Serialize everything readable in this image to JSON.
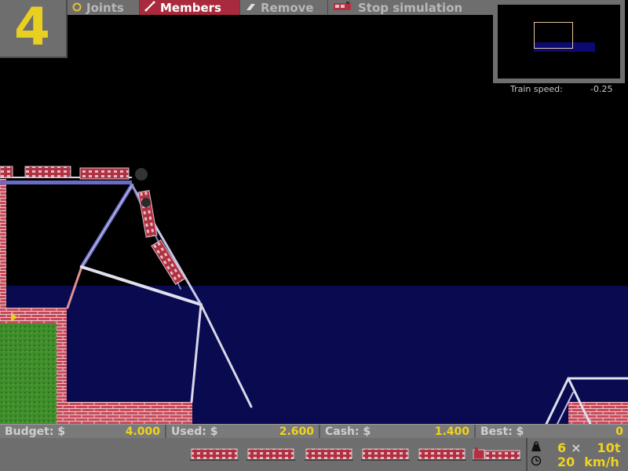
{
  "level": "4",
  "toolbar": {
    "joints_label": "Joints",
    "members_label": "Members",
    "remove_label": "Remove",
    "stop_label": "Stop simulation",
    "active_tool": "members"
  },
  "train_speed": {
    "label": "Train speed:",
    "value": "-0.25"
  },
  "budget": {
    "budget_label": "Budget:",
    "budget_value": "4.000",
    "used_label": "Used:",
    "used_value": "2.600",
    "cash_label": "Cash:",
    "cash_value": "1.400",
    "best_label": "Best:",
    "best_value": "0",
    "currency": "$"
  },
  "train": {
    "cars_count": "6",
    "times": "×",
    "weight": "10t",
    "speed": "20",
    "speed_unit": "km/h"
  },
  "colors": {
    "panel": "#6e6e6e",
    "active_tool": "#a82a3c",
    "value_yellow": "#f0d21e",
    "water": "#0a0a50",
    "brick": "#c04050",
    "grass": "#3a8a2a"
  },
  "icons": [
    "joint-icon",
    "member-icon",
    "eraser-icon",
    "train-icon",
    "weight-icon",
    "clock-icon"
  ]
}
